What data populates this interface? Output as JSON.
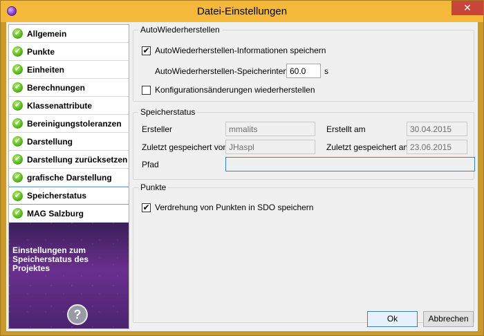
{
  "window": {
    "title": "Datei-Einstellungen",
    "close_glyph": "✕"
  },
  "sidebar": {
    "items": [
      {
        "label": "Allgemein"
      },
      {
        "label": "Punkte"
      },
      {
        "label": "Einheiten"
      },
      {
        "label": "Berechnungen"
      },
      {
        "label": "Klassenattribute"
      },
      {
        "label": "Bereinigungstoleranzen"
      },
      {
        "label": "Darstellung"
      },
      {
        "label": "Darstellung zurücksetzen"
      },
      {
        "label": "grafische Darstellung"
      },
      {
        "label": "Speicherstatus"
      },
      {
        "label": "MAG Salzburg"
      }
    ],
    "selected": "Speicherstatus",
    "promo_text": "Einstellungen zum Speicherstatus des Projektes",
    "help_glyph": "?"
  },
  "autosave": {
    "title": "AutoWiederherstellen",
    "save_info_label": "AutoWiederherstellen-Informationen speichern",
    "save_info_checked": true,
    "interval_label": "AutoWiederherstellen-Speicherinterval:",
    "interval_value": "60.0",
    "interval_unit": "s",
    "restore_config_label": "Konfigurationsänderungen wiederherstellen",
    "restore_config_checked": false
  },
  "status": {
    "title": "Speicherstatus",
    "creator_label": "Ersteller",
    "creator_value": "mmalits",
    "created_label": "Erstellt am",
    "created_value": "30.04.2015",
    "last_saved_by_label": "Zuletzt gespeichert von",
    "last_saved_by_value": "JHaspl",
    "last_saved_label": "Zuletzt gespeichert am",
    "last_saved_value": "23.06.2015",
    "path_label": "Pfad",
    "path_value": ""
  },
  "points": {
    "title": "Punkte",
    "rotation_label": "Verdrehung von Punkten in SDO speichern",
    "rotation_checked": true
  },
  "footer": {
    "ok_label": "Ok",
    "cancel_label": "Abbrechen"
  },
  "check_glyph": "✔"
}
